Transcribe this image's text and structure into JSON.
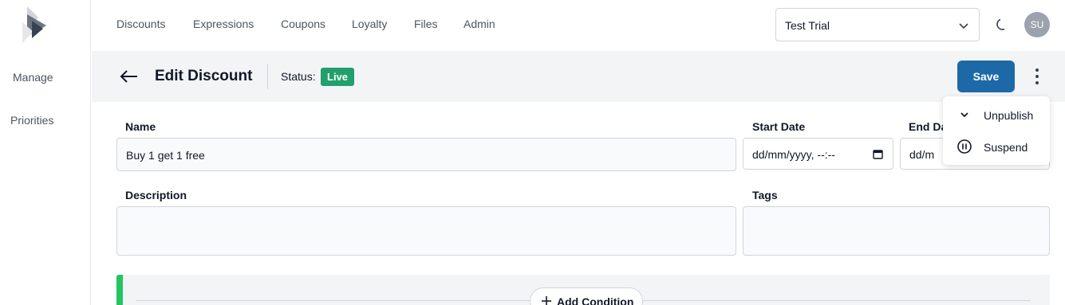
{
  "sidebar": {
    "items": [
      {
        "label": "Manage"
      },
      {
        "label": "Priorities"
      }
    ]
  },
  "topnav": {
    "links": [
      {
        "label": "Discounts"
      },
      {
        "label": "Expressions"
      },
      {
        "label": "Coupons"
      },
      {
        "label": "Loyalty"
      },
      {
        "label": "Files"
      },
      {
        "label": "Admin"
      }
    ],
    "org_select": {
      "value": "Test Trial"
    },
    "avatar_initials": "SU"
  },
  "header": {
    "title": "Edit Discount",
    "status_label": "Status:",
    "status_value": "Live",
    "save_label": "Save",
    "status_color": "#22a06b",
    "save_color": "#1d69a8"
  },
  "form": {
    "name": {
      "label": "Name",
      "value": "Buy 1 get 1 free"
    },
    "start_date": {
      "label": "Start Date",
      "value": "dd/mm/yyyy, --:--"
    },
    "end_date": {
      "label": "End Da",
      "value": "dd/m"
    },
    "description": {
      "label": "Description",
      "value": ""
    },
    "tags": {
      "label": "Tags",
      "value": ""
    }
  },
  "menu": {
    "items": [
      {
        "label": "Unpublish",
        "icon": "chevron-down-icon"
      },
      {
        "label": "Suspend",
        "icon": "pause-circle-icon"
      }
    ]
  },
  "conditions": {
    "add_label": "Add Condition",
    "accent_color": "#22c55e"
  }
}
